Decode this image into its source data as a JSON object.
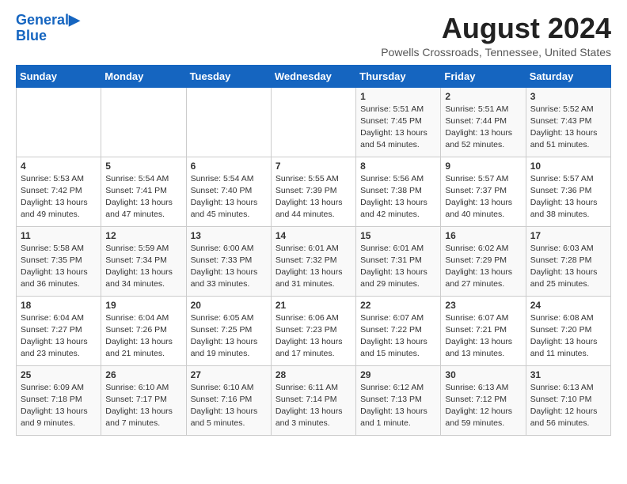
{
  "logo": {
    "line1": "General",
    "line2": "Blue"
  },
  "title": "August 2024",
  "subtitle": "Powells Crossroads, Tennessee, United States",
  "days_of_week": [
    "Sunday",
    "Monday",
    "Tuesday",
    "Wednesday",
    "Thursday",
    "Friday",
    "Saturday"
  ],
  "weeks": [
    [
      {
        "day": "",
        "info": ""
      },
      {
        "day": "",
        "info": ""
      },
      {
        "day": "",
        "info": ""
      },
      {
        "day": "",
        "info": ""
      },
      {
        "day": "1",
        "info": "Sunrise: 5:51 AM\nSunset: 7:45 PM\nDaylight: 13 hours\nand 54 minutes."
      },
      {
        "day": "2",
        "info": "Sunrise: 5:51 AM\nSunset: 7:44 PM\nDaylight: 13 hours\nand 52 minutes."
      },
      {
        "day": "3",
        "info": "Sunrise: 5:52 AM\nSunset: 7:43 PM\nDaylight: 13 hours\nand 51 minutes."
      }
    ],
    [
      {
        "day": "4",
        "info": "Sunrise: 5:53 AM\nSunset: 7:42 PM\nDaylight: 13 hours\nand 49 minutes."
      },
      {
        "day": "5",
        "info": "Sunrise: 5:54 AM\nSunset: 7:41 PM\nDaylight: 13 hours\nand 47 minutes."
      },
      {
        "day": "6",
        "info": "Sunrise: 5:54 AM\nSunset: 7:40 PM\nDaylight: 13 hours\nand 45 minutes."
      },
      {
        "day": "7",
        "info": "Sunrise: 5:55 AM\nSunset: 7:39 PM\nDaylight: 13 hours\nand 44 minutes."
      },
      {
        "day": "8",
        "info": "Sunrise: 5:56 AM\nSunset: 7:38 PM\nDaylight: 13 hours\nand 42 minutes."
      },
      {
        "day": "9",
        "info": "Sunrise: 5:57 AM\nSunset: 7:37 PM\nDaylight: 13 hours\nand 40 minutes."
      },
      {
        "day": "10",
        "info": "Sunrise: 5:57 AM\nSunset: 7:36 PM\nDaylight: 13 hours\nand 38 minutes."
      }
    ],
    [
      {
        "day": "11",
        "info": "Sunrise: 5:58 AM\nSunset: 7:35 PM\nDaylight: 13 hours\nand 36 minutes."
      },
      {
        "day": "12",
        "info": "Sunrise: 5:59 AM\nSunset: 7:34 PM\nDaylight: 13 hours\nand 34 minutes."
      },
      {
        "day": "13",
        "info": "Sunrise: 6:00 AM\nSunset: 7:33 PM\nDaylight: 13 hours\nand 33 minutes."
      },
      {
        "day": "14",
        "info": "Sunrise: 6:01 AM\nSunset: 7:32 PM\nDaylight: 13 hours\nand 31 minutes."
      },
      {
        "day": "15",
        "info": "Sunrise: 6:01 AM\nSunset: 7:31 PM\nDaylight: 13 hours\nand 29 minutes."
      },
      {
        "day": "16",
        "info": "Sunrise: 6:02 AM\nSunset: 7:29 PM\nDaylight: 13 hours\nand 27 minutes."
      },
      {
        "day": "17",
        "info": "Sunrise: 6:03 AM\nSunset: 7:28 PM\nDaylight: 13 hours\nand 25 minutes."
      }
    ],
    [
      {
        "day": "18",
        "info": "Sunrise: 6:04 AM\nSunset: 7:27 PM\nDaylight: 13 hours\nand 23 minutes."
      },
      {
        "day": "19",
        "info": "Sunrise: 6:04 AM\nSunset: 7:26 PM\nDaylight: 13 hours\nand 21 minutes."
      },
      {
        "day": "20",
        "info": "Sunrise: 6:05 AM\nSunset: 7:25 PM\nDaylight: 13 hours\nand 19 minutes."
      },
      {
        "day": "21",
        "info": "Sunrise: 6:06 AM\nSunset: 7:23 PM\nDaylight: 13 hours\nand 17 minutes."
      },
      {
        "day": "22",
        "info": "Sunrise: 6:07 AM\nSunset: 7:22 PM\nDaylight: 13 hours\nand 15 minutes."
      },
      {
        "day": "23",
        "info": "Sunrise: 6:07 AM\nSunset: 7:21 PM\nDaylight: 13 hours\nand 13 minutes."
      },
      {
        "day": "24",
        "info": "Sunrise: 6:08 AM\nSunset: 7:20 PM\nDaylight: 13 hours\nand 11 minutes."
      }
    ],
    [
      {
        "day": "25",
        "info": "Sunrise: 6:09 AM\nSunset: 7:18 PM\nDaylight: 13 hours\nand 9 minutes."
      },
      {
        "day": "26",
        "info": "Sunrise: 6:10 AM\nSunset: 7:17 PM\nDaylight: 13 hours\nand 7 minutes."
      },
      {
        "day": "27",
        "info": "Sunrise: 6:10 AM\nSunset: 7:16 PM\nDaylight: 13 hours\nand 5 minutes."
      },
      {
        "day": "28",
        "info": "Sunrise: 6:11 AM\nSunset: 7:14 PM\nDaylight: 13 hours\nand 3 minutes."
      },
      {
        "day": "29",
        "info": "Sunrise: 6:12 AM\nSunset: 7:13 PM\nDaylight: 13 hours\nand 1 minute."
      },
      {
        "day": "30",
        "info": "Sunrise: 6:13 AM\nSunset: 7:12 PM\nDaylight: 12 hours\nand 59 minutes."
      },
      {
        "day": "31",
        "info": "Sunrise: 6:13 AM\nSunset: 7:10 PM\nDaylight: 12 hours\nand 56 minutes."
      }
    ]
  ]
}
